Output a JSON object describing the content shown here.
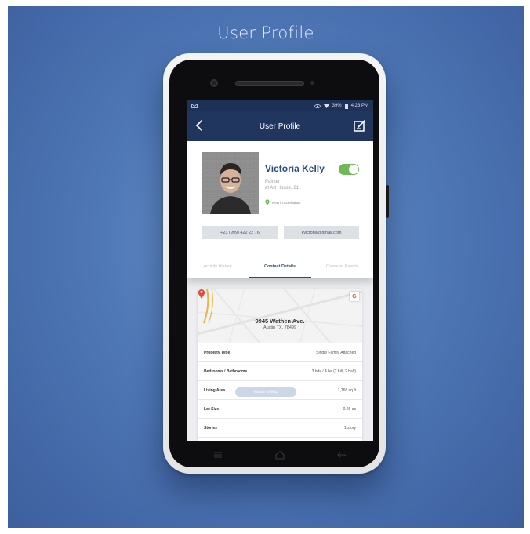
{
  "showcase": {
    "title": "User Profile"
  },
  "status_bar": {
    "battery": "39%",
    "time": "4:23 PM"
  },
  "header": {
    "title": "User Profile"
  },
  "profile": {
    "name": "Victoria Kelly",
    "role_line1": "Painter",
    "role_line2": "at Art House, 21'",
    "location": "New in Azerbaijan",
    "toggle_on": true
  },
  "contact": {
    "phone": "+23 (999) 422 22 76",
    "email": "kvictoria@gmail.com"
  },
  "tabs": [
    {
      "label": "Activity History",
      "active": false
    },
    {
      "label": "Contact Details",
      "active": true
    },
    {
      "label": "Calendar Events",
      "active": false
    }
  ],
  "address": {
    "line1": "9945 Wathen Ave.",
    "line2": "Austin TX, 78499"
  },
  "properties": [
    {
      "label": "Property Type",
      "value": "Single Family Attached"
    },
    {
      "label": "Bedrooms / Bathrooms",
      "value": "3 bds / 4 ba (2 full, 2 half)"
    },
    {
      "label": "Living Area",
      "value": "1,768 sq ft"
    },
    {
      "label": "Lot Size",
      "value": "0.26 ac"
    },
    {
      "label": "Stories",
      "value": "1 story"
    }
  ],
  "map_button": {
    "label": "Visible in Map"
  },
  "colors": {
    "header": "#20365f",
    "accent": "#2b4a7e",
    "toggle": "#6fba56",
    "background": "#4f78b6"
  }
}
